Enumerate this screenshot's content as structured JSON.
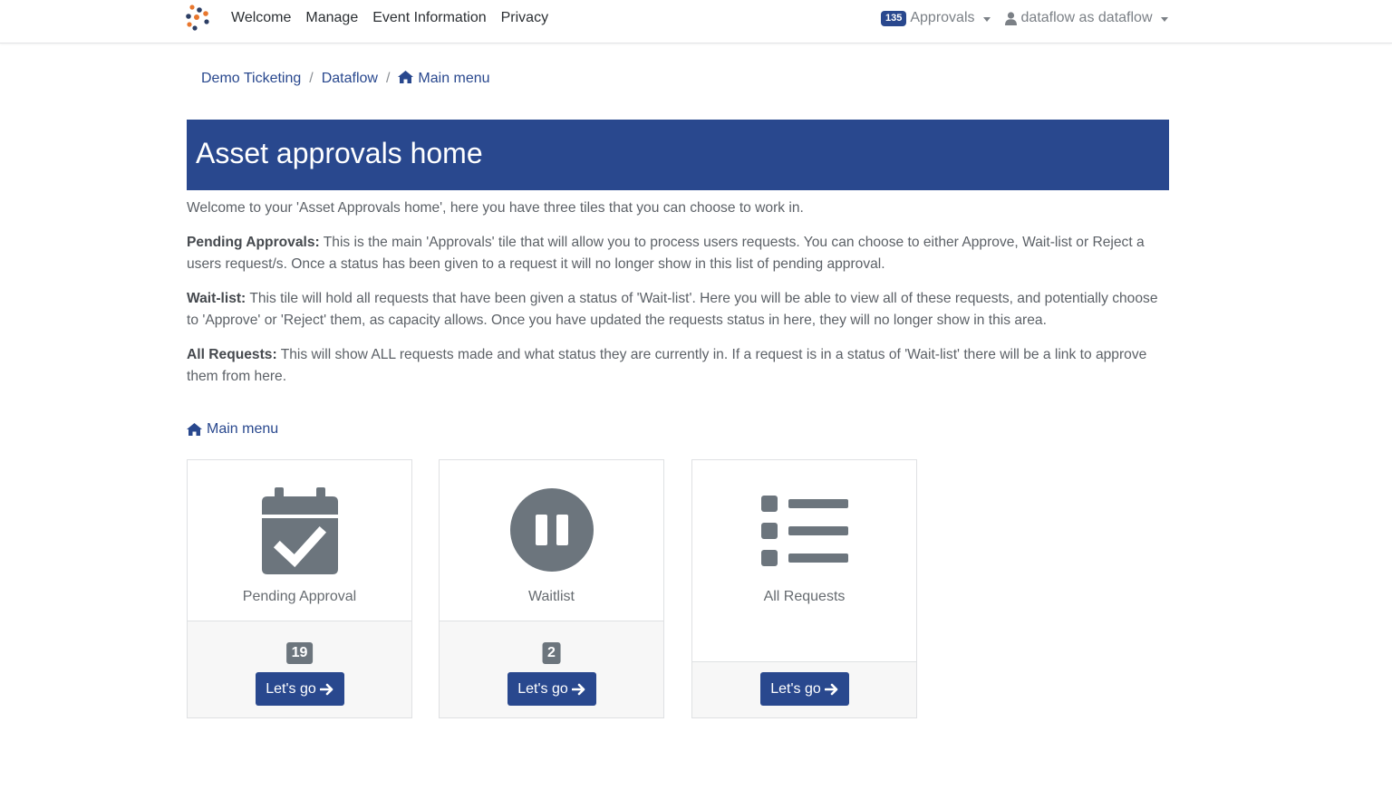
{
  "nav": {
    "links": [
      "Welcome",
      "Manage",
      "Event Information",
      "Privacy"
    ],
    "approvals_count": "135",
    "approvals_label": "Approvals",
    "user_label": "dataflow as dataflow"
  },
  "breadcrumb": {
    "items": [
      "Demo Ticketing",
      "Dataflow",
      "Main menu"
    ]
  },
  "banner": {
    "title": "Asset approvals home"
  },
  "intro": {
    "welcome": "Welcome to your 'Asset Approvals home', here you have three tiles that you can choose to work in.",
    "pending_title": "Pending Approvals:",
    "pending_text": " This is the main 'Approvals' tile that will allow you to process users requests. You can choose to either Approve, Wait-list or Reject a users request/s. Once a status has been given to a request it will no longer show in this list of pending approval.",
    "waitlist_title": "Wait-list:",
    "waitlist_text": " This tile will hold all requests that have been given a status of 'Wait-list'. Here you will be able to view all of these requests, and potentially choose to 'Approve' or 'Reject' them, as capacity allows. Once you have updated the requests status in here, they will no longer show in this area.",
    "all_title": "All Requests:",
    "all_text": " This will show ALL requests made and what status they are currently in. If a request is in a status of 'Wait-list' there will be a link to approve them from here."
  },
  "main_menu_link": "Main menu",
  "tiles": [
    {
      "label": "Pending Approval",
      "count": "19",
      "button": "Let's go",
      "icon": "calendar-check-icon"
    },
    {
      "label": "Waitlist",
      "count": "2",
      "button": "Let's go",
      "icon": "pause-circle-icon"
    },
    {
      "label": "All Requests",
      "button": "Let's go",
      "icon": "list-icon"
    }
  ],
  "colors": {
    "brand": "#29488e",
    "icon_gray": "#6c757d",
    "badge_gray": "#6c757d"
  }
}
